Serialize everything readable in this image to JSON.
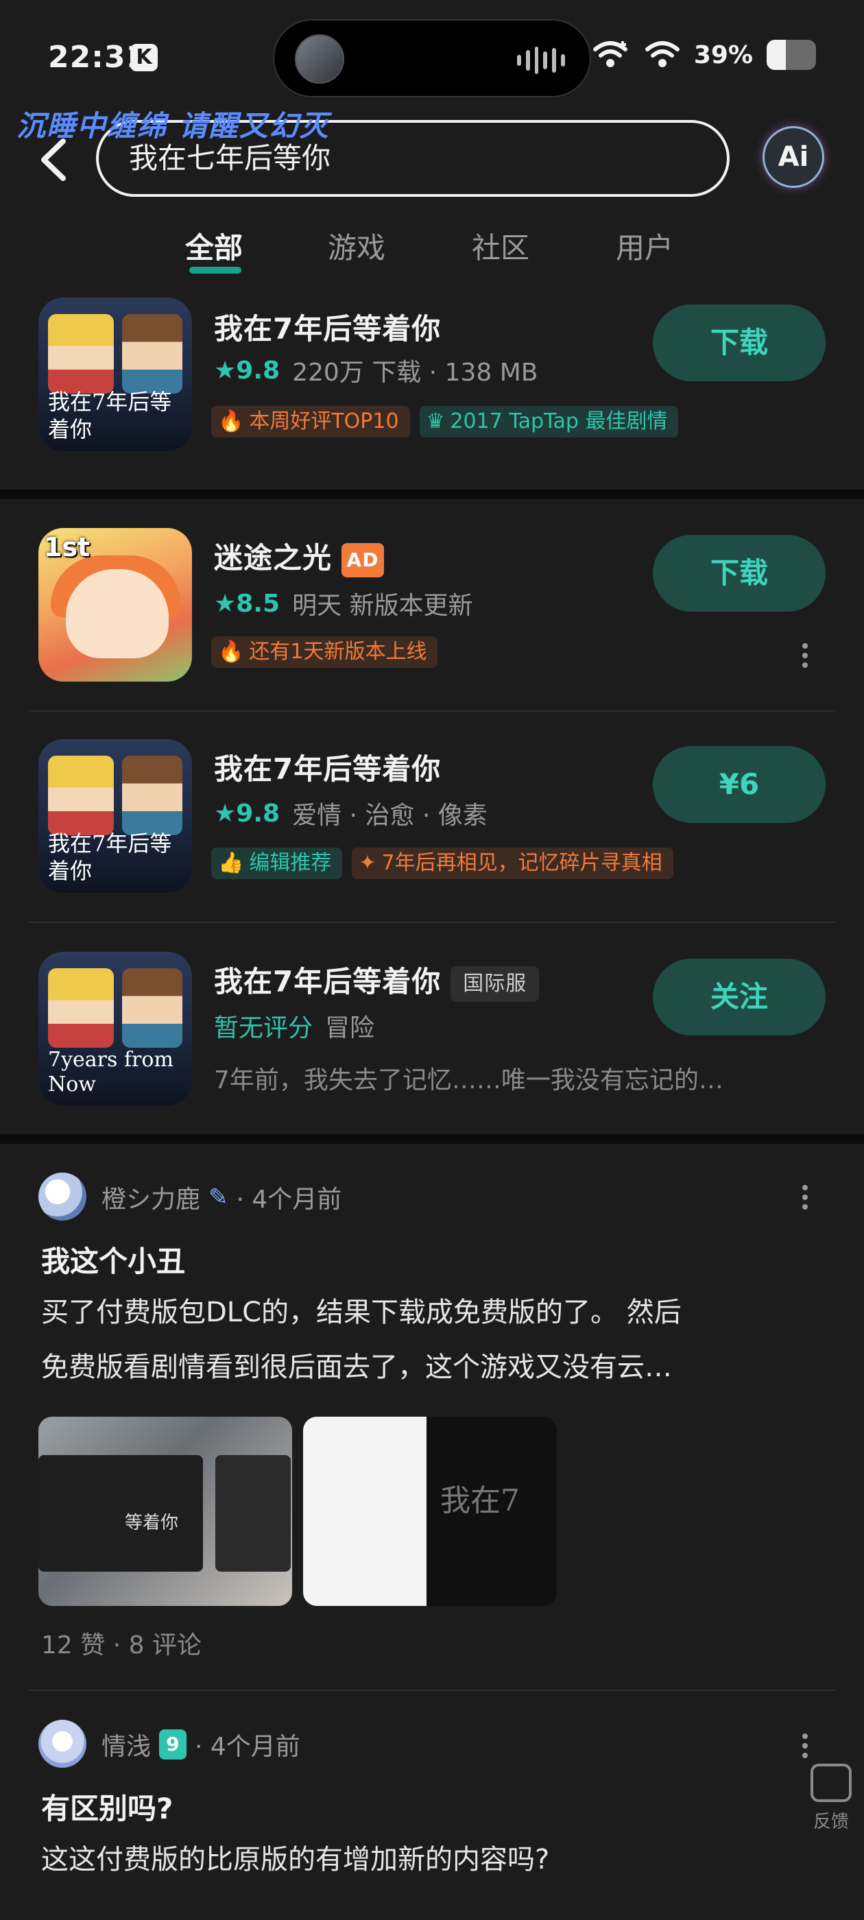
{
  "status_bar": {
    "time": "22:31",
    "carrier_badge": "K",
    "battery_percent": "39%",
    "battery_level": 0.39,
    "icons": [
      "wifi-plus-icon",
      "wifi-icon",
      "battery-icon"
    ]
  },
  "overlay_marquee": "沉睡中缠绵 请醒又幻灭",
  "search": {
    "query": "我在七年后等你",
    "ai_label": "Ai"
  },
  "tabs": [
    {
      "label": "全部",
      "active": true
    },
    {
      "label": "游戏",
      "active": false
    },
    {
      "label": "社区",
      "active": false
    },
    {
      "label": "用户",
      "active": false
    }
  ],
  "apps": [
    {
      "title": "我在7年后等着你",
      "rating": "9.8",
      "meta": "220万 下载 · 138 MB",
      "button": "下载",
      "icon_caption": "我在7年后等着你",
      "tags": [
        {
          "text": "本周好评TOP10",
          "style": "orange",
          "icon": "fire-icon"
        },
        {
          "text": "2017 TapTap 最佳剧情",
          "style": "green",
          "icon": "trophy-icon"
        }
      ]
    },
    {
      "title": "迷途之光",
      "badge": "AD",
      "rating": "8.5",
      "meta": "明天 新版本更新",
      "button": "下载",
      "icon_caption": "1st",
      "tags": [
        {
          "text": "还有1天新版本上线",
          "style": "orange",
          "icon": "fire-icon"
        }
      ]
    },
    {
      "title": "我在7年后等着你",
      "rating": "9.8",
      "meta": "爱情 · 治愈 · 像素",
      "button": "¥6",
      "icon_caption": "我在7年后等着你",
      "tags": [
        {
          "text": "编辑推荐",
          "style": "green",
          "icon": "thumbs-up-icon"
        },
        {
          "text": "7年后再相见，记忆碎片寻真相",
          "style": "orange",
          "icon": "sparkle-icon"
        }
      ]
    },
    {
      "title": "我在7年后等着你",
      "badge": "国际服",
      "no_rating": "暂无评分",
      "meta": "冒险",
      "button": "关注",
      "icon_caption": "7years from Now",
      "desc": "7年前，我失去了记忆……唯一我没有忘记的…"
    }
  ],
  "posts": [
    {
      "user": "橙シ力鹿",
      "time": "· 4个月前",
      "title": "我这个小丑",
      "body": [
        "买了付费版包DLC的，结果下载成免费版的了。 然后",
        "免费版看剧情看到很后面去了，这个游戏又没有云…"
      ],
      "stats": "12 赞 · 8 评论",
      "thumb1_label": "等着你",
      "thumb2_label": "我在7"
    },
    {
      "user": "情浅",
      "level": "9",
      "time": "· 4个月前",
      "title": "有区别吗?",
      "body": [
        "这这付费版的比原版的有增加新的内容吗?"
      ]
    }
  ],
  "feedback_label": "反馈"
}
